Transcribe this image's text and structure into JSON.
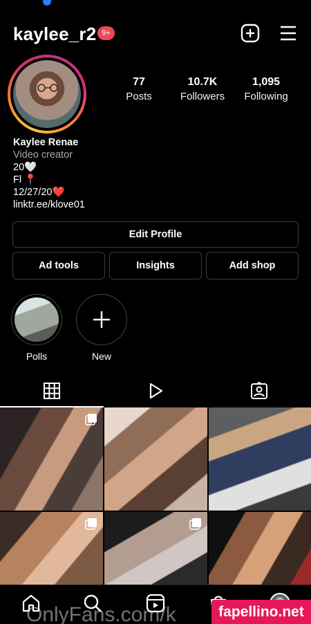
{
  "header": {
    "username": "kaylee_r2",
    "notification_badge": "9+",
    "add_icon": "plus-square-icon",
    "menu_icon": "hamburger-menu-icon"
  },
  "profile": {
    "stats": [
      {
        "value": "77",
        "label": "Posts"
      },
      {
        "value": "10.7K",
        "label": "Followers"
      },
      {
        "value": "1,095",
        "label": "Following"
      }
    ],
    "bio": {
      "name": "Kaylee Renae",
      "category": "Video creator",
      "lines": [
        "20🤍",
        "Fl 📍",
        "12/27/20❤️"
      ],
      "link": "linktr.ee/klove01"
    }
  },
  "buttons": {
    "edit_profile": "Edit Profile",
    "ad_tools": "Ad tools",
    "insights": "Insights",
    "add_shop": "Add shop"
  },
  "highlights": [
    {
      "label": "Polls"
    },
    {
      "label": "New"
    }
  ],
  "tabs": [
    {
      "icon": "grid-icon",
      "active": true
    },
    {
      "icon": "reels-icon",
      "active": false
    },
    {
      "icon": "tagged-icon",
      "active": false
    }
  ],
  "bottom_nav": [
    "home-icon",
    "search-icon",
    "reels-icon",
    "shop-icon",
    "profile-icon"
  ],
  "watermarks": {
    "onlyfans": "OnlyFans.com/k",
    "site": "fapellino.net"
  },
  "colors": {
    "badge": "#ed4956",
    "watermark_bg": "#e7185a",
    "background": "#000000"
  }
}
